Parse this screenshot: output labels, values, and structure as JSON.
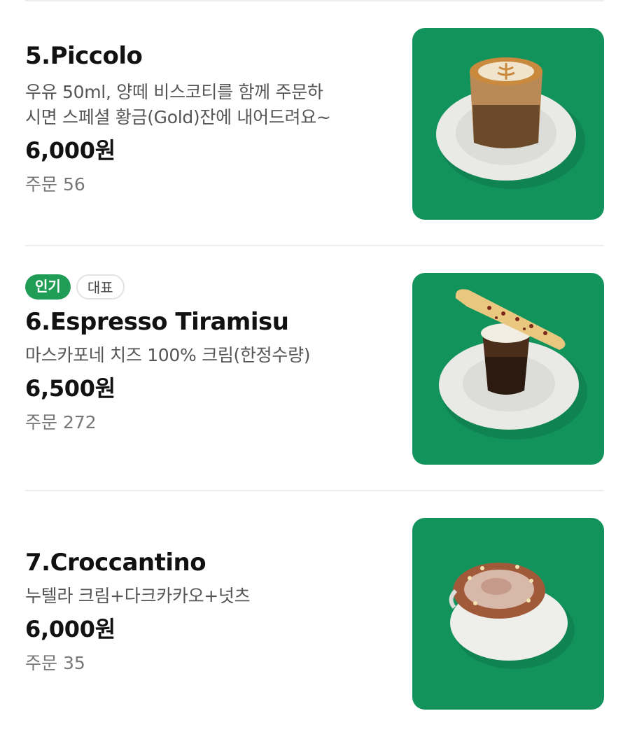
{
  "menu_items": [
    {
      "name": "5.Piccolo",
      "badges": [],
      "description_lines": [
        "우유 50ml, 양떼 비스코티를 함께 주문하",
        "시면 스페셜 황금(Gold)잔에 내어드려요~"
      ],
      "price": "6,000원",
      "orders": "주문 56",
      "image_icon": "piccolo-photo"
    },
    {
      "name": "6.Espresso Tiramisu",
      "badges": [
        {
          "label": "인기",
          "style": "filled",
          "color": "#1f9d56"
        },
        {
          "label": "대표",
          "style": "outline"
        }
      ],
      "description_lines": [
        "마스카포네 치즈 100% 크림(한정수량)"
      ],
      "price": "6,500원",
      "orders": "주문 272",
      "image_icon": "tiramisu-photo"
    },
    {
      "name": "7.Croccantino",
      "badges": [],
      "description_lines": [
        "누텔라 크림+다크카카오+넛츠"
      ],
      "price": "6,000원",
      "orders": "주문 35",
      "image_icon": "croccantino-photo"
    }
  ],
  "colors": {
    "thumbnail_background": "#13935c",
    "popular_badge": "#1f9d56",
    "divider": "#ededed"
  }
}
